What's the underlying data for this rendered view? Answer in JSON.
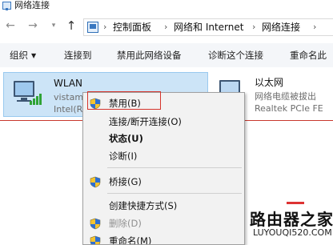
{
  "window": {
    "title": "网络连接"
  },
  "nav": {
    "back_icon": "back-arrow",
    "forward_icon": "forward-arrow",
    "recent_icon": "chevron-down",
    "up_icon": "up-arrow"
  },
  "breadcrumb": {
    "separator": "›",
    "items": [
      "控制面板",
      "网络和 Internet",
      "网络连接"
    ]
  },
  "toolbar": {
    "organize": "组织",
    "connect_to": "连接到",
    "disable_device": "禁用此网络设备",
    "diagnose": "诊断这个连接",
    "rename": "重命名此"
  },
  "connections": [
    {
      "name": "WLAN",
      "subtitle": "vistam",
      "device": "Intel(R"
    },
    {
      "name": "以太网",
      "subtitle": "网络电缆被拔出",
      "device": "Realtek PCIe FE"
    }
  ],
  "context_menu": {
    "items": [
      {
        "label": "禁用(B)",
        "icon": "shield-icon",
        "bold": false,
        "disabled": false
      },
      {
        "label": "连接/断开连接(O)",
        "icon": "",
        "bold": false,
        "disabled": false
      },
      {
        "label": "状态(U)",
        "icon": "",
        "bold": true,
        "disabled": false
      },
      {
        "label": "诊断(I)",
        "icon": "",
        "bold": false,
        "disabled": false
      },
      {
        "label": "桥接(G)",
        "icon": "shield-icon",
        "bold": false,
        "disabled": false
      },
      {
        "label": "创建快捷方式(S)",
        "icon": "",
        "bold": false,
        "disabled": false
      },
      {
        "label": "删除(D)",
        "icon": "shield-icon",
        "bold": false,
        "disabled": true
      },
      {
        "label": "重命名(M)",
        "icon": "shield-icon",
        "bold": false,
        "disabled": false
      }
    ]
  },
  "watermark": {
    "title": "路由器之家",
    "url": "LUYOUQI520.COM"
  },
  "colors": {
    "selection_bg": "#cce4f7",
    "highlight_border": "#d5352c",
    "signal_green": "#2fa335"
  }
}
